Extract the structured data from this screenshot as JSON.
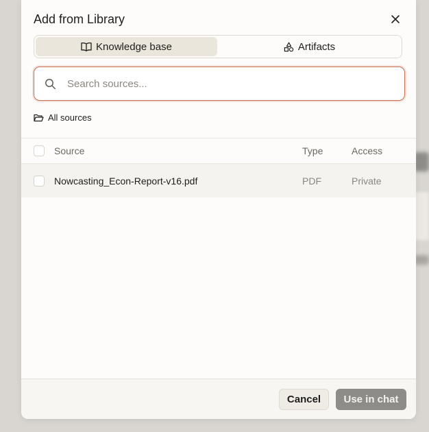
{
  "dialog": {
    "title": "Add from Library"
  },
  "tabs": [
    {
      "label": "Knowledge base",
      "icon": "book-open-icon",
      "active": true
    },
    {
      "label": "Artifacts",
      "icon": "shapes-icon",
      "active": false
    }
  ],
  "search": {
    "placeholder": "Search sources...",
    "value": ""
  },
  "breadcrumb": {
    "label": "All sources",
    "icon": "folder-open-icon"
  },
  "table": {
    "columns": [
      "Source",
      "Type",
      "Access"
    ],
    "rows": [
      {
        "source": "Nowcasting_Econ-Report-v16.pdf",
        "type": "PDF",
        "access": "Private"
      }
    ]
  },
  "footer": {
    "cancel_label": "Cancel",
    "use_label": "Use in chat"
  },
  "colors": {
    "accent": "#c96f4f",
    "active_tab": "#ebe6dc",
    "disabled_button": "#8e8c88"
  }
}
